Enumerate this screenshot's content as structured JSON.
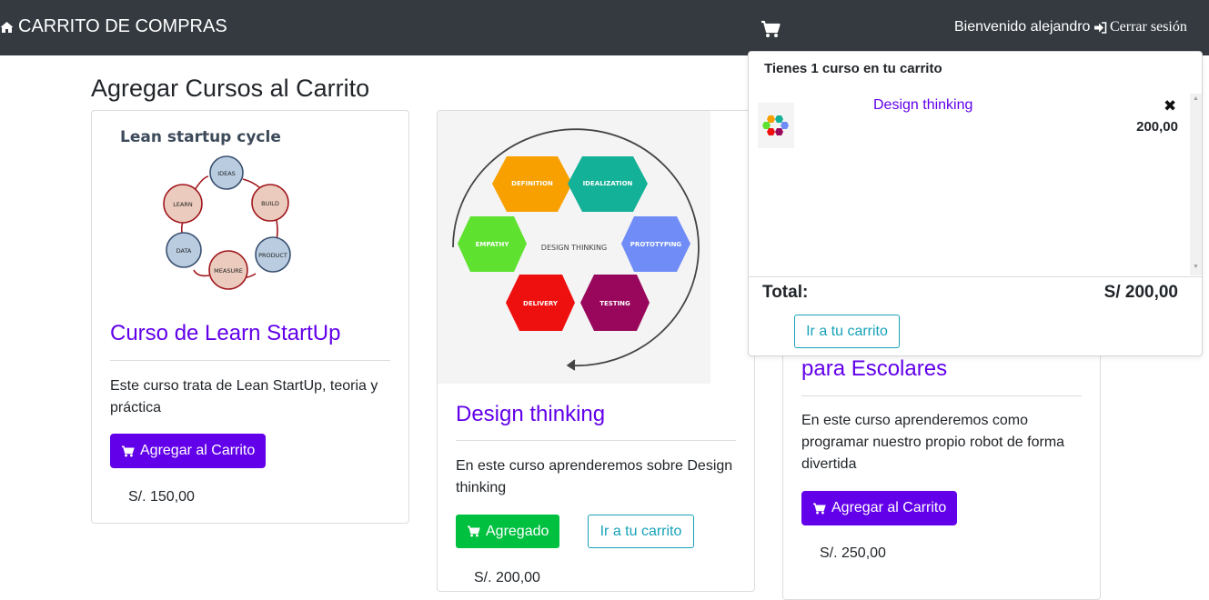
{
  "navbar": {
    "brand": "CARRITO DE COMPRAS",
    "welcome": "Bienvenido alejandro",
    "logout": "Cerrar sesión"
  },
  "page_title": "Agregar Cursos al Carrito",
  "courses": [
    {
      "title": "Curso de Learn StartUp",
      "image_heading": "Lean startup cycle",
      "cycle_nodes": [
        "IDEAS",
        "BUILD",
        "PRODUCT",
        "MEASURE",
        "DATA",
        "LEARN"
      ],
      "description": "Este curso trata de Lean StartUp, teoria y práctica",
      "button": "Agregar al Carrito",
      "price": "S/. 150,00"
    },
    {
      "title": "Design thinking",
      "image_center": "DESIGN THINKING",
      "hexagons": [
        "DEFINITION",
        "IDEALIZATION",
        "EMPATHY",
        "PROTOTYPING",
        "DELIVERY",
        "TESTING"
      ],
      "description": "En este curso aprenderemos sobre Design thinking",
      "button_added": "Agregado",
      "button_cart": "Ir a tu carrito",
      "price": "S/. 200,00"
    },
    {
      "title_partial": "para Escolares",
      "description": "En este curso aprenderemos como programar nuestro propio robot de forma divertida",
      "button": "Agregar al Carrito",
      "price": "S/. 250,00"
    }
  ],
  "cart_dropdown": {
    "header": "Tienes 1 curso en tu carrito",
    "items": [
      {
        "name": "Design thinking",
        "price": "200,00"
      }
    ],
    "total_label": "Total:",
    "total_value": "S/ 200,00",
    "button": "Ir a tu carrito"
  },
  "colors": {
    "navbar": "#343a40",
    "accent_purple": "#6200ea",
    "success_green": "#00c040",
    "info_teal": "#17a2b8"
  }
}
